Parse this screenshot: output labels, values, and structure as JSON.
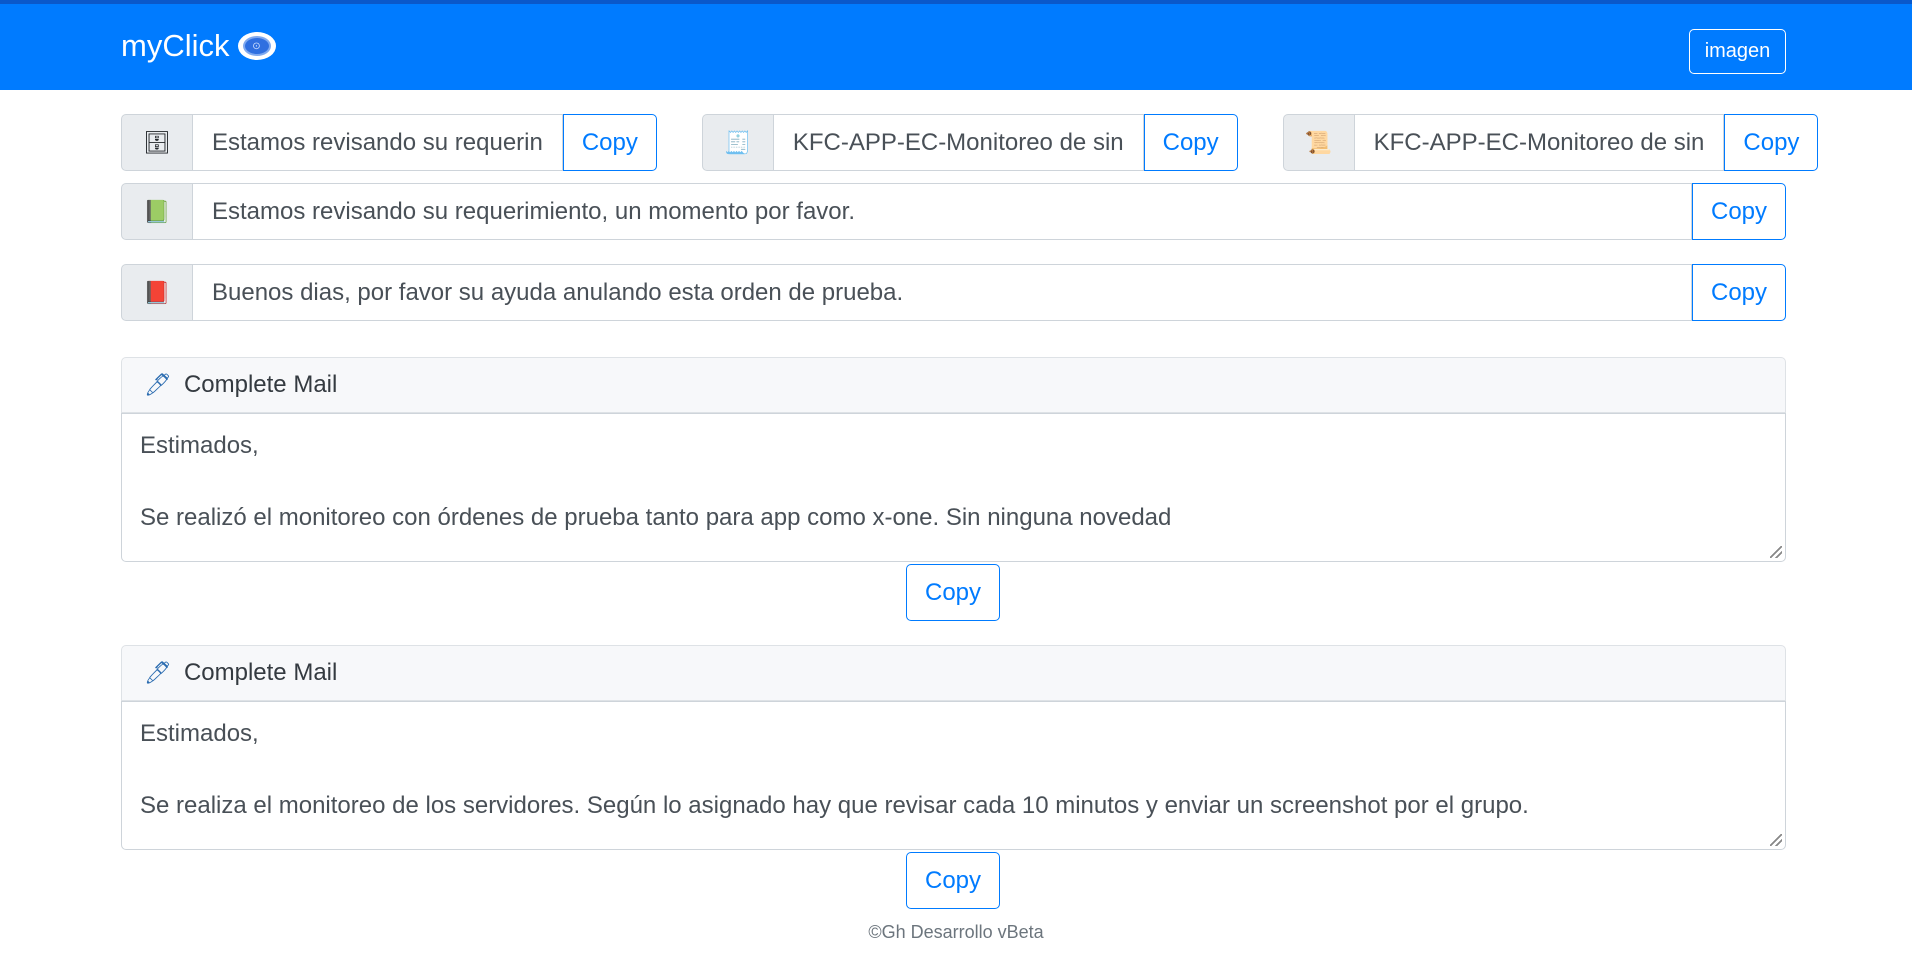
{
  "navbar": {
    "brand": "myClick",
    "button_label": "imagen"
  },
  "quick_fields": [
    {
      "icon": "server-icon",
      "glyph": "🗄",
      "value": "Estamos revisando su requerin",
      "copy_label": "Copy"
    },
    {
      "icon": "receipt-icon",
      "glyph": "🧾",
      "value": "KFC-APP-EC-Monitoreo de sin",
      "copy_label": "Copy"
    },
    {
      "icon": "scroll-icon",
      "glyph": "📜",
      "value": "KFC-APP-EC-Monitoreo de sin",
      "copy_label": "Copy"
    }
  ],
  "wide_fields": [
    {
      "icon": "green-book-icon",
      "glyph": "📗",
      "value": "Estamos revisando su requerimiento, un momento por favor.",
      "copy_label": "Copy"
    },
    {
      "icon": "red-book-icon",
      "glyph": "📕",
      "value": "Buenos dias, por favor su ayuda anulando esta orden de prueba.",
      "copy_label": "Copy"
    }
  ],
  "mail_cards": [
    {
      "header": "Complete Mail",
      "line1": "Estimados,",
      "line2": "",
      "line3": "Se realizó el monitoreo con órdenes de prueba tanto para app como x-one. Sin ninguna novedad",
      "copy_label": "Copy"
    },
    {
      "header": "Complete Mail",
      "line1": "Estimados,",
      "line2": "",
      "line3": "Se realiza el monitoreo de los servidores. Según lo asignado hay que revisar cada 10 minutos y enviar un screenshot por el grupo.",
      "copy_label": "Copy"
    }
  ],
  "footer": "©Gh Desarrollo vBeta",
  "colors": {
    "primary": "#007bff",
    "addon_bg": "#e9ecef",
    "card_header_bg": "#f7f8fa"
  }
}
